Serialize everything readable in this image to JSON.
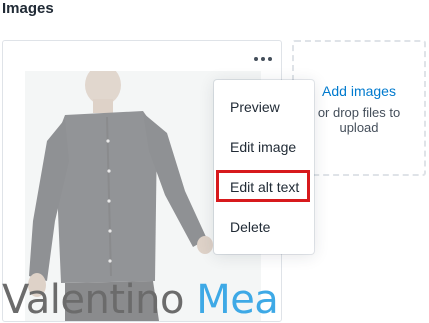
{
  "section": {
    "title": "Images"
  },
  "image_card": {
    "more_icon": "horizontal-dots-icon",
    "menu": {
      "items": [
        {
          "label": "Preview"
        },
        {
          "label": "Edit image"
        },
        {
          "label": "Edit alt text",
          "highlighted": true
        },
        {
          "label": "Delete"
        }
      ]
    }
  },
  "dropzone": {
    "add_label": "Add images",
    "hint": "or drop files to upload"
  },
  "watermark": {
    "part1": "Valentino ",
    "part2": "Mea"
  },
  "colors": {
    "link": "#007ace",
    "highlight": "#d7191c",
    "watermark_gray": "#6b6b6b",
    "watermark_blue": "#3ea9e6"
  }
}
